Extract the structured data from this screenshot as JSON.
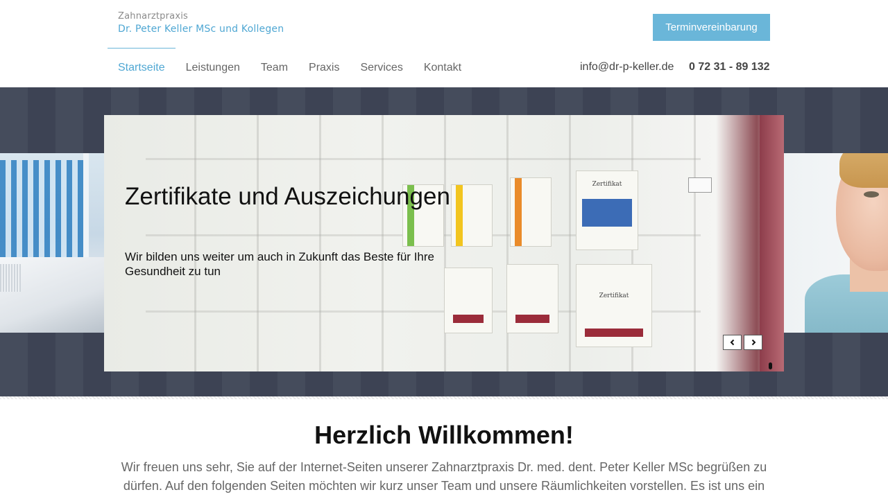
{
  "header": {
    "logo": {
      "line1": "Zahnarztpraxis",
      "line2": "Dr. Peter Keller MSc und Kollegen"
    },
    "cta_label": "Terminvereinbarung",
    "nav": [
      {
        "label": "Startseite",
        "active": true
      },
      {
        "label": "Leistungen",
        "active": false
      },
      {
        "label": "Team",
        "active": false
      },
      {
        "label": "Praxis",
        "active": false
      },
      {
        "label": "Services",
        "active": false
      },
      {
        "label": "Kontakt",
        "active": false
      }
    ],
    "email": "info@dr-p-keller.de",
    "phone": "0 72 31 - 89 132"
  },
  "slider": {
    "title": "Zertifikate und Auszeichungen",
    "text": "Wir bilden uns weiter um auch in Zukunft das Beste für Ihre Gesundheit zu tun",
    "prev_icon": "chevron-left-icon",
    "next_icon": "chevron-right-icon",
    "certificate_labels": [
      "Zertifikat",
      "Zertifikat"
    ]
  },
  "welcome": {
    "title": "Herzlich Willkommen!",
    "text": "Wir freuen uns sehr, Sie auf der Internet-Seiten unserer Zahnarztpraxis Dr. med. dent. Peter Keller MSc begrüßen zu dürfen. Auf den folgenden Seiten möchten wir kurz unser Team und unsere Räumlichkeiten vorstellen.  Es ist uns ein"
  },
  "colors": {
    "accent": "#6ab6d9",
    "brand_text": "#4fa7d3",
    "hero_band": "#3f4657"
  }
}
